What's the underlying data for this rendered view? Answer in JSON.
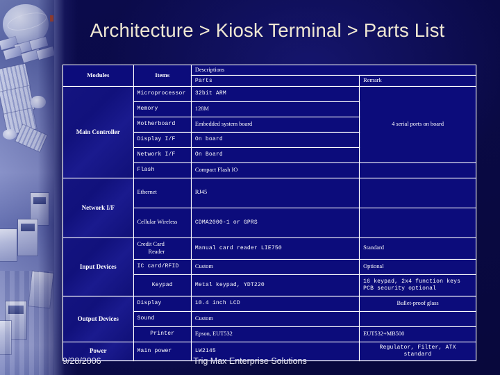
{
  "slide": {
    "title": "Architecture > Kiosk Terminal > Parts List",
    "footer": {
      "date": "9/28/2006",
      "company": "Trig Max Enterprise Solutions"
    },
    "colors": {
      "background": "#0a0a46",
      "cell_fill": "#0c0c7b",
      "cell_border": "#ffffff",
      "title_text": "#efe7d2",
      "body_text": "#ffffff",
      "strip_tint": "#8892c8"
    }
  },
  "table": {
    "headers": {
      "modules": "Modules",
      "items": "Items",
      "descriptions": "Descriptions",
      "parts": "Parts",
      "remark": "Remark"
    },
    "rows": [
      {
        "module": "Main Controller",
        "item": "Microprocessor",
        "parts": "32bit ARM",
        "remark": ""
      },
      {
        "module": "",
        "item": "Memory",
        "parts": "128M",
        "remark": ""
      },
      {
        "module": "",
        "item": "Motherboard",
        "parts": "Embedded system board",
        "remark": "4 serial ports on board"
      },
      {
        "module": "",
        "item": "Display I/F",
        "parts": "On board",
        "remark": ""
      },
      {
        "module": "",
        "item": "Network I/F",
        "parts": "On Board",
        "remark": ""
      },
      {
        "module": "",
        "item": "Flash",
        "parts": "Compact Flash IO",
        "remark": ""
      },
      {
        "module": "Network I/F",
        "item": "Ethernet",
        "parts": "RJ45",
        "remark": ""
      },
      {
        "module": "",
        "item": "Cellular Wireless",
        "parts": "CDMA2000-1 or GPRS",
        "remark": ""
      },
      {
        "module": "Input Devices",
        "item": "Credit Card Reader",
        "parts": "Manual card reader LIE750",
        "remark": "Standard"
      },
      {
        "module": "",
        "item": "IC card/RFID",
        "parts": "Custom",
        "remark": "Optional"
      },
      {
        "module": "",
        "item": "Keypad",
        "parts": "Metal keypad, YDT220",
        "remark": "16 keypad, 2x4 function keys PCB security optional"
      },
      {
        "module": "Output Devices",
        "item": "Display",
        "parts": "10.4 inch LCD",
        "remark": "Bullet-proof glass"
      },
      {
        "module": "",
        "item": "Sound",
        "parts": "Custom",
        "remark": ""
      },
      {
        "module": "",
        "item": "Printer",
        "parts": "Epson, EUT532",
        "remark": "EUT532+MB500"
      },
      {
        "module": "Power",
        "item": "Main power",
        "parts": "LW2145",
        "remark": "Regulator, Filter, ATX standard"
      }
    ],
    "item_labels": {
      "credit_card_line1": "Credit Card",
      "credit_card_line2": "Reader",
      "keypad_remark_line1": "16 keypad, 2x4 function keys",
      "keypad_remark_line2": "PCB security optional",
      "power_remark_line1": "Regulator, Filter, ATX",
      "power_remark_line2": "standard"
    }
  }
}
